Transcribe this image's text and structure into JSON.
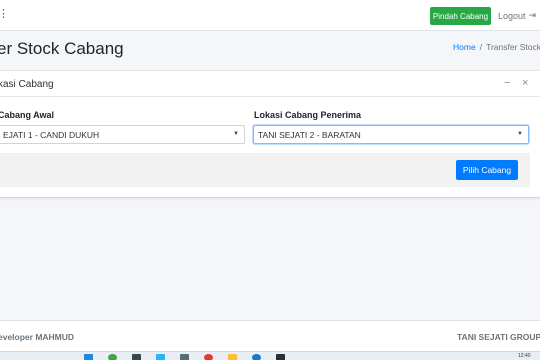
{
  "navbar": {
    "toggle_icon": "hamburger-icon",
    "pindah_label": "Pindah Cabang",
    "logout_label": "Logout",
    "logout_icon": "sign-out-icon",
    "pindah_color": "#28a745"
  },
  "header": {
    "title": "er Stock Cabang",
    "breadcrumb": {
      "home": "Home",
      "separator": "/",
      "current": "Transfer Stock"
    }
  },
  "card": {
    "title": "kasi Cabang",
    "left": {
      "label": "Cabang Awal",
      "value": "EJATI 1 - CANDI DUKUH"
    },
    "right": {
      "label": "Lokasi Cabang Penerima",
      "value": "TANI SEJATI 2 - BARATAN"
    },
    "submit_label": "Pilih Cabang",
    "submit_color": "#007bff"
  },
  "footer": {
    "left": "eveloper MAHMUD",
    "right": "TANI SEJATI GROUP"
  },
  "taskbar": {
    "clock": "12:40"
  }
}
